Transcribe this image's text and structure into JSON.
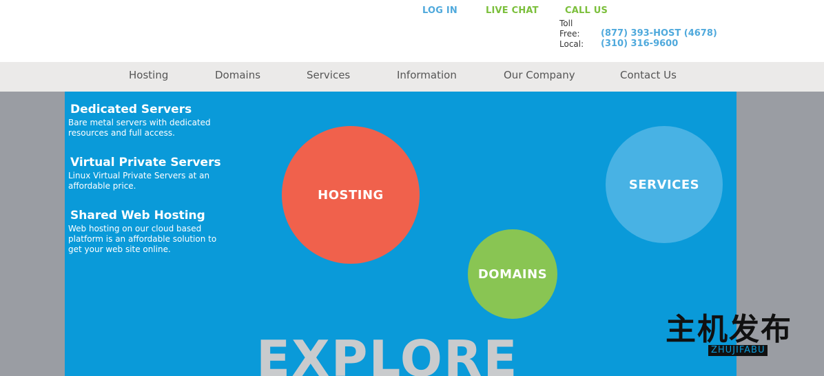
{
  "topbar": {
    "login": "LOG IN",
    "livechat": "LIVE CHAT",
    "callus": "CALL US",
    "toll_label_1": "Toll",
    "toll_label_2": "Free:",
    "toll_number": "(877) 393-HOST (4678)",
    "local_label": "Local:",
    "local_number": "(310) 316-9600"
  },
  "nav": {
    "items": [
      {
        "label": "Hosting"
      },
      {
        "label": "Domains"
      },
      {
        "label": "Services"
      },
      {
        "label": "Information"
      },
      {
        "label": "Our Company"
      },
      {
        "label": "Contact Us"
      }
    ]
  },
  "features": [
    {
      "title": "Dedicated Servers",
      "desc": "Bare metal servers with dedicated resources and full access."
    },
    {
      "title": "Virtual Private Servers",
      "desc": "Linux Virtual Private Servers at an affordable price."
    },
    {
      "title": "Shared Web Hosting",
      "desc": "Web hosting on our cloud based platform is an affordable solution to get your web site online."
    }
  ],
  "bubbles": {
    "hosting": "HOSTING",
    "services": "SERVICES",
    "domains": "DOMAINS"
  },
  "hero": {
    "explore": "EXPLORE"
  },
  "watermark": {
    "cn": "主机发布",
    "en": "ZHUJIFABU"
  },
  "colors": {
    "panel": "#0a9ad9",
    "hosting": "#f0614c",
    "services": "#48b2e4",
    "domains": "#89c553",
    "link_blue": "#4fa9dc",
    "link_green": "#7bbf3b"
  }
}
